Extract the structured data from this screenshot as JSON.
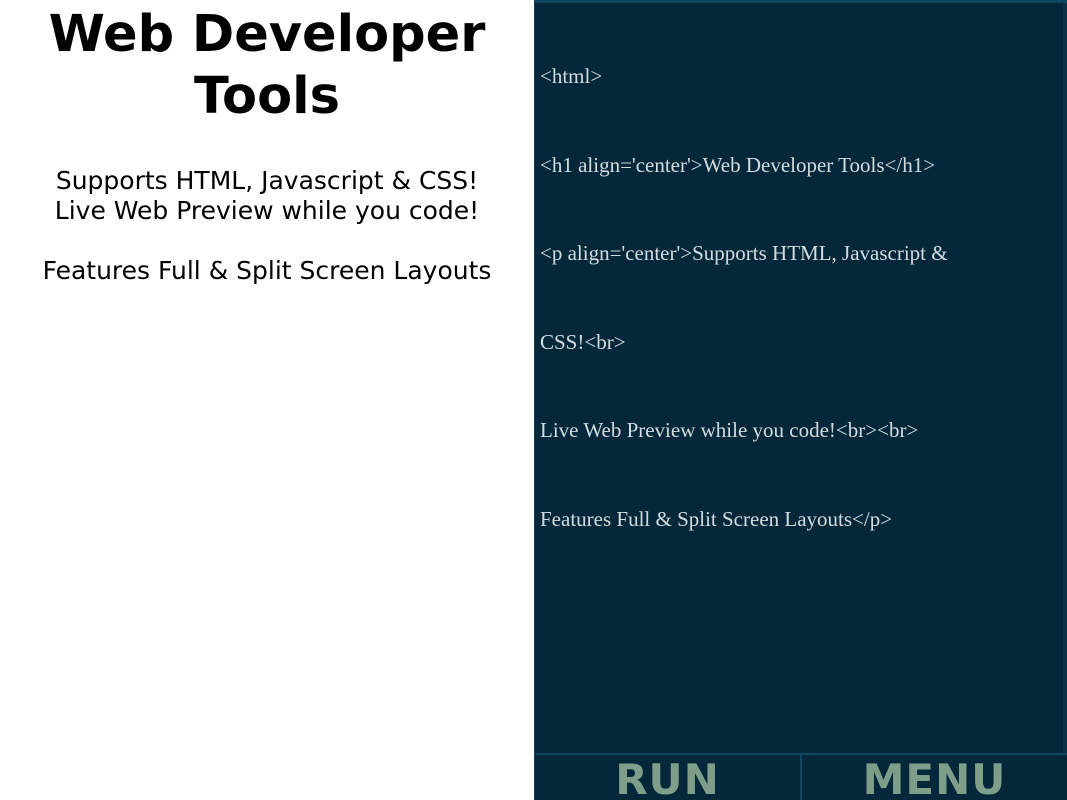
{
  "preview": {
    "title_line1": "Web Developer",
    "title_line2": "Tools",
    "para_line1": "Supports HTML, Javascript & CSS!",
    "para_line2": "Live Web Preview while you code!",
    "para_line3": "Features Full & Split Screen Layouts"
  },
  "editor": {
    "code_lines": [
      "<html>",
      "<h1 align='center'>Web Developer Tools</h1>",
      "<p align='center'>Supports HTML, Javascript &",
      "CSS!<br>",
      "Live Web Preview while you code!<br><br>",
      "Features Full & Split Screen Layouts</p>"
    ]
  },
  "toolbar": {
    "run_label": "RUN",
    "menu_label": "MENU"
  },
  "colors": {
    "editor_background": "#04283a",
    "code_text": "#d4dce0",
    "button_text": "#7e9e8a",
    "preview_background": "#ffffff"
  }
}
